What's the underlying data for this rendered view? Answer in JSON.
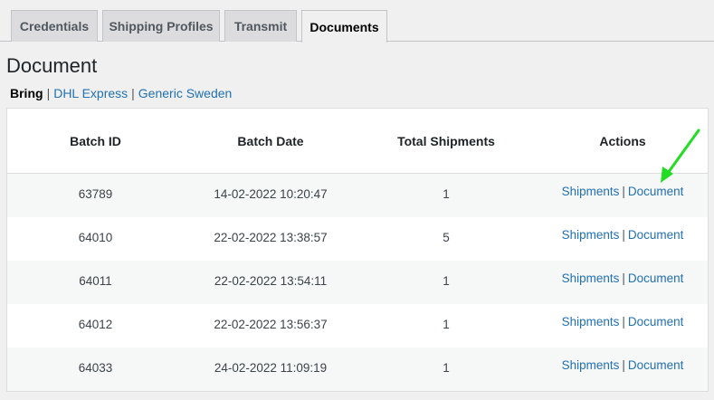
{
  "tabs": [
    {
      "label": "Credentials",
      "active": false
    },
    {
      "label": "Shipping Profiles",
      "active": false
    },
    {
      "label": "Transmit",
      "active": false
    },
    {
      "label": "Documents",
      "active": true
    }
  ],
  "page_title": "Document",
  "carriers": {
    "current": "Bring",
    "others": [
      "DHL Express",
      "Generic Sweden"
    ],
    "separator": "|"
  },
  "table": {
    "headers": [
      "Batch ID",
      "Batch Date",
      "Total Shipments",
      "Actions"
    ],
    "rows": [
      {
        "batch_id": "63789",
        "batch_date": "14-02-2022 10:20:47",
        "total": "1"
      },
      {
        "batch_id": "64010",
        "batch_date": "22-02-2022 13:38:57",
        "total": "5"
      },
      {
        "batch_id": "64011",
        "batch_date": "22-02-2022 13:54:11",
        "total": "1"
      },
      {
        "batch_id": "64012",
        "batch_date": "22-02-2022 13:56:37",
        "total": "1"
      },
      {
        "batch_id": "64033",
        "batch_date": "24-02-2022 11:09:19",
        "total": "1"
      }
    ],
    "action_labels": {
      "shipments": "Shipments",
      "document": "Document",
      "separator": "|"
    }
  },
  "annotation": {
    "arrow_color": "#22dd22",
    "arrow_icon": "arrow-pointer-icon"
  },
  "colors": {
    "link": "#2271b1",
    "background": "#f0f0f1"
  }
}
